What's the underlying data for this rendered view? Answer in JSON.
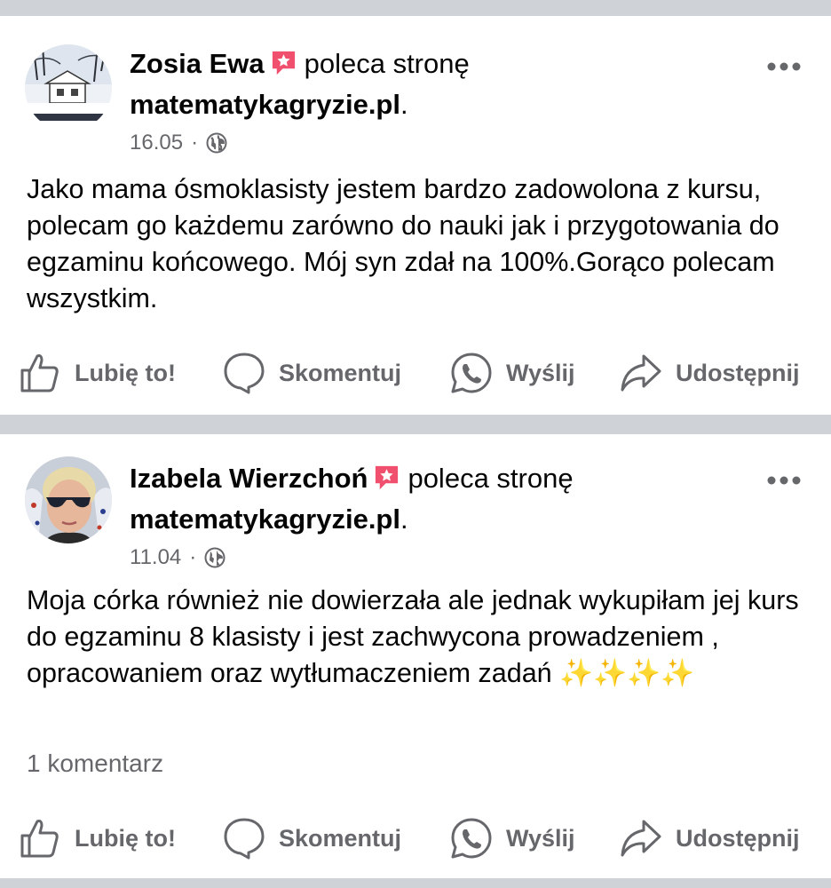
{
  "colors": {
    "separator": "#cfd3d8",
    "secondary_text": "#65676b",
    "badge": "#f0506e"
  },
  "posts": [
    {
      "author": "Zosia Ewa",
      "recommends": "poleca stronę",
      "page": "matematykagryzie.pl",
      "page_suffix": ".",
      "date": "16.05",
      "meta_separator": "·",
      "text": "Jako mama ósmoklasisty jestem bardzo zadowolona z kursu, polecam go każdemu  zarówno do nauki jak i przygotowania do egzaminu końcowego. Mój syn zdał na 100%.Gorąco polecam wszystkim.",
      "avatar_icon": "house-winter-avatar",
      "actions": {
        "like": "Lubię to!",
        "comment": "Skomentuj",
        "send": "Wyślij",
        "share": "Udostępnij"
      }
    },
    {
      "author": "Izabela Wierzchoń",
      "recommends": "poleca stronę",
      "page": "matematykagryzie.pl",
      "page_suffix": ".",
      "date": "11.04",
      "meta_separator": "·",
      "text": "Moja córka również nie dowierzała ale jednak wykupiłam jej kurs do egzaminu 8 klasisty i jest zachwycona prowadzeniem , opracowaniem oraz wytłumaczeniem zadań ✨✨✨✨",
      "comments_count": "1 komentarz",
      "avatar_icon": "woman-sunglasses-avatar",
      "actions": {
        "like": "Lubię to!",
        "comment": "Skomentuj",
        "send": "Wyślij",
        "share": "Udostępnij"
      }
    }
  ]
}
